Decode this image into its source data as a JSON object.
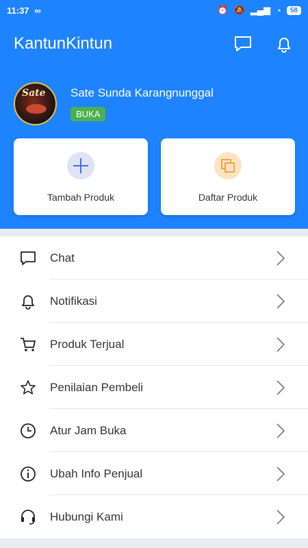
{
  "status_bar": {
    "time": "11:37",
    "battery": "58"
  },
  "app": {
    "title": "KantunKintun"
  },
  "store": {
    "name": "Sate Sunda Karangnunggal",
    "status": "BUKA",
    "logo_text": "Sate"
  },
  "cards": [
    {
      "label": "Tambah Produk",
      "icon": "plus-icon"
    },
    {
      "label": "Daftar Produk",
      "icon": "copy-icon"
    }
  ],
  "menu": [
    {
      "label": "Chat",
      "icon": "chat-icon"
    },
    {
      "label": "Notifikasi",
      "icon": "bell-icon"
    },
    {
      "label": "Produk Terjual",
      "icon": "cart-icon"
    },
    {
      "label": "Penilaian Pembeli",
      "icon": "star-icon"
    },
    {
      "label": "Atur Jam Buka",
      "icon": "clock-icon"
    },
    {
      "label": "Ubah Info Penjual",
      "icon": "info-icon"
    },
    {
      "label": "Hubungi Kami",
      "icon": "headset-icon"
    }
  ],
  "colors": {
    "primary": "#1e83ff",
    "badge": "#4caf50",
    "plus_circle": "#dfe3f5",
    "copy_circle": "#fde3c6"
  }
}
